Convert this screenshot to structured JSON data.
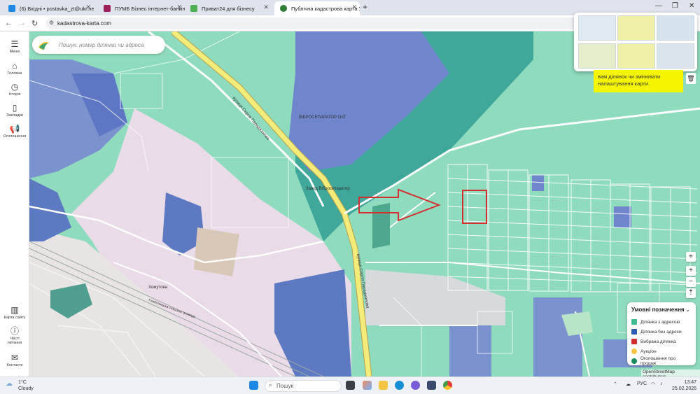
{
  "tabs": [
    {
      "title": "(6) Вхідні • postavka_zt@ukr.ne",
      "color": "#1e88e5"
    },
    {
      "title": "ПУМБ Бізнес інтернет-банкін",
      "color": "#9c1f5b"
    },
    {
      "title": "Приват24 для бізнесу",
      "color": "#4caf50"
    },
    {
      "title": "Публічна кадастрова карта Ук",
      "color": "#2e7d32"
    }
  ],
  "address": {
    "url": "kadastrova-karta.com"
  },
  "sidebar": {
    "items": [
      {
        "label": "Меню",
        "icon": "menu-icon"
      },
      {
        "label": "Головна",
        "icon": "home-icon"
      },
      {
        "label": "Історія",
        "icon": "history-icon"
      },
      {
        "label": "Закладки",
        "icon": "bookmark-icon"
      },
      {
        "label": "Оголошення",
        "icon": "megaphone-icon"
      },
      {
        "label": "Карта сайту",
        "icon": "sitemap-icon"
      },
      {
        "label": "Часті питання",
        "icon": "faq-icon"
      },
      {
        "label": "Контакти",
        "icon": "contacts-icon"
      }
    ]
  },
  "search": {
    "placeholder": "Пошук: номер ділянки чи адреса"
  },
  "tooltip": {
    "text": "вам ділянок чи змінювати налаштування карти."
  },
  "map": {
    "labels": {
      "street1": "вулиця Сергія Параджанова",
      "street2": "вулиця Сергія Параджанова",
      "factory": "ВІБРОСЕПАРАТОР ОАТ",
      "stop": "Завод Вібросепаратор",
      "village": "Хомутова",
      "community": "Глибочицька сільська громада"
    },
    "colors": {
      "parcel_address": "#3fb990",
      "parcel_no_address": "#2f5bb5",
      "selected": "#d32f2f",
      "base": "#8fdbbd"
    }
  },
  "legend": {
    "title": "Умовні позначення",
    "items": [
      {
        "label": "Ділянка з адресою",
        "color": "#3fb990"
      },
      {
        "label": "Ділянка без адреси",
        "color": "#2f5bb5"
      },
      {
        "label": "Вибрана ділянка",
        "color": "#d32f2f"
      },
      {
        "label": "Аукціон",
        "color": "#f4c542"
      },
      {
        "label": "Оголошення про продаж",
        "color": "#1b8a5a"
      }
    ]
  },
  "attribution": "OpenStreetMap contributors",
  "taskbar": {
    "weather_temp": "1°C",
    "weather_desc": "Cloudy",
    "search_label": "Пошук",
    "lang": "РУС",
    "time": "13:47",
    "date": "25.02.2026"
  }
}
